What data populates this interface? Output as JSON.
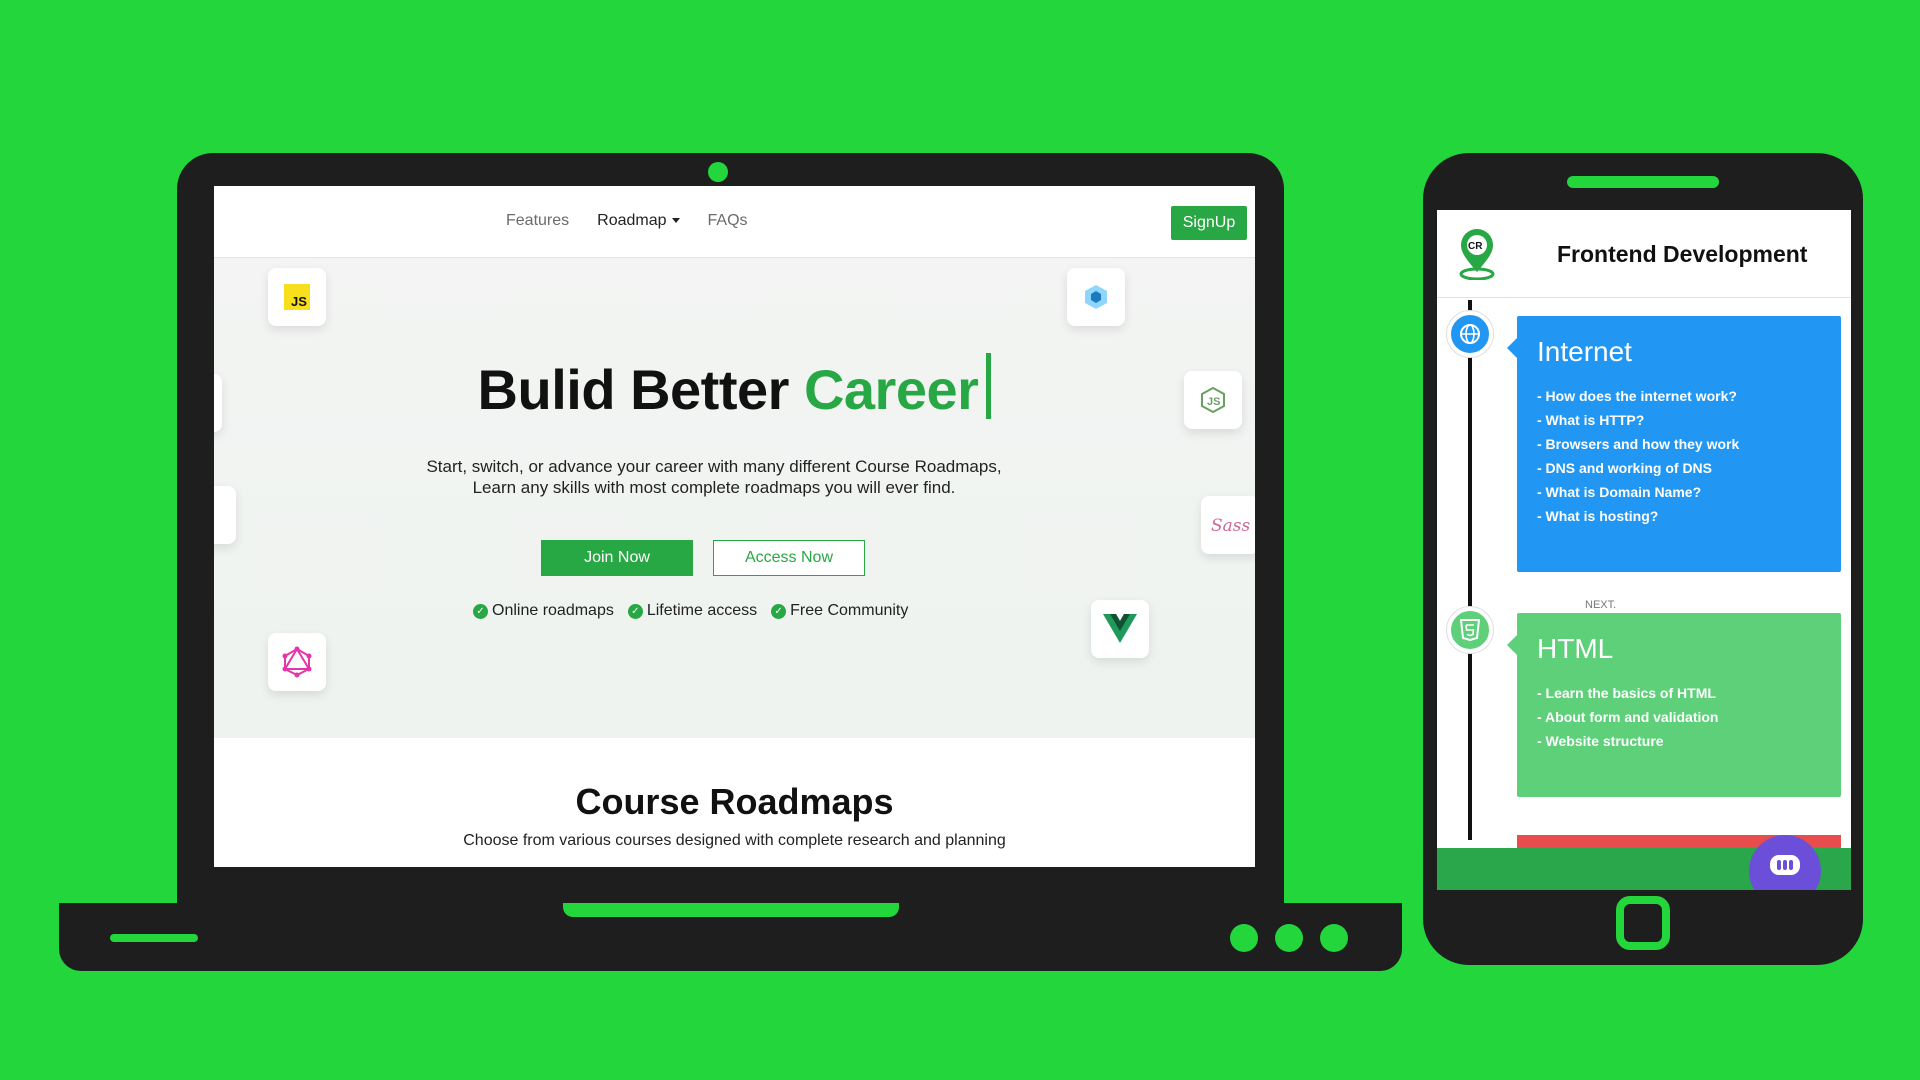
{
  "laptop": {
    "nav": {
      "links": [
        "Features",
        "Roadmap",
        "FAQs"
      ],
      "signup": "SignUp"
    },
    "hero": {
      "title_part1": "Bulid Better",
      "title_part2": "Career",
      "subtitle": "Start, switch, or advance your career with many different Course Roadmaps, Learn any skills with most complete roadmaps you will ever find.",
      "join_button": "Join Now",
      "access_button": "Access Now",
      "features": [
        "Online roadmaps",
        "Lifetime access",
        "Free Community"
      ]
    },
    "tiles": [
      "javascript-icon",
      "webpack-icon",
      "nodejs-icon",
      "sass-icon",
      "vue-icon",
      "graphql-icon"
    ],
    "section": {
      "title": "Course Roadmaps",
      "subtitle": "Choose from various courses designed with complete research and planning"
    }
  },
  "phone": {
    "app_title": "Frontend Development",
    "logo_text": "CR",
    "cards": [
      {
        "title": "Internet",
        "items": [
          "- How does the internet work?",
          "- What is HTTP?",
          "- Browsers and how they work",
          "- DNS and working of DNS",
          "- What is Domain Name?",
          "- What is hosting?"
        ]
      },
      {
        "title": "HTML",
        "items": [
          "- Learn the basics of HTML",
          "- About form and validation",
          "- Website structure"
        ]
      }
    ],
    "mini_label": "NEXT."
  },
  "colors": {
    "background": "#22d63c",
    "device": "#1e1e1e",
    "brand": "#28a745",
    "internet_card": "#2196f3",
    "html_card": "#5fd07a"
  }
}
